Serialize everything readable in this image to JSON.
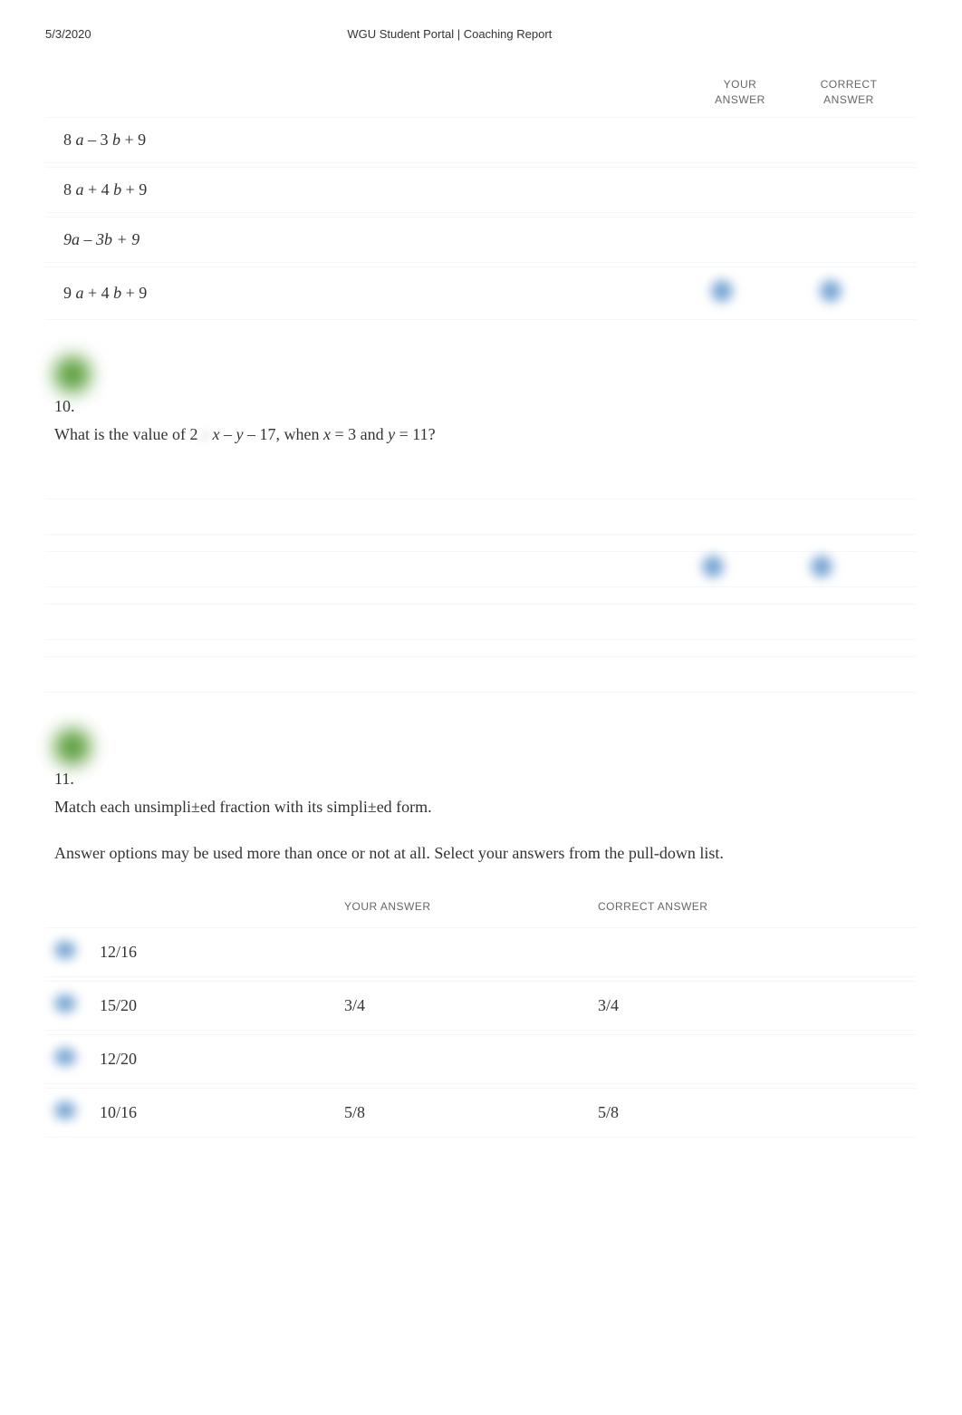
{
  "header": {
    "date": "5/3/2020",
    "title": "WGU Student Portal | Coaching Report"
  },
  "columns": {
    "your_answer": "YOUR ANSWER",
    "correct_answer": "CORRECT ANSWER"
  },
  "q9_options": [
    {
      "text": "8 a – 3  b + 9",
      "your": false,
      "correct": false
    },
    {
      "text": "8 a + 4  b + 9",
      "your": false,
      "correct": false
    },
    {
      "text": "9a – 3b + 9",
      "your": false,
      "correct": false,
      "italic": true
    },
    {
      "text": "9 a + 4  b + 9",
      "your": true,
      "correct": true
    }
  ],
  "q10": {
    "number": "10.",
    "text_parts": {
      "p1": "What is the value of 2",
      "p2": "x",
      "p3": "  –  ",
      "p4": "y",
      "p5": " – 17, when   ",
      "p6": "x",
      "p7": " = 3 and  ",
      "p8": "y",
      "p9": " = 11?"
    },
    "rows": [
      {
        "your": false,
        "correct": false
      },
      {
        "your": true,
        "correct": true
      },
      {
        "your": false,
        "correct": false
      },
      {
        "your": false,
        "correct": false
      }
    ]
  },
  "q11": {
    "number": "11.",
    "prompt": "Match each unsimpli±ed fraction with its simpli±ed form.",
    "note": "Answer options may be used more than once or not at all. Select your answers from the pull-down list.",
    "headers": {
      "your": "YOUR ANSWER",
      "correct": "CORRECT ANSWER"
    },
    "rows": [
      {
        "fraction": "12/16",
        "your": "",
        "correct": ""
      },
      {
        "fraction": "15/20",
        "your": "3/4",
        "correct": "3/4"
      },
      {
        "fraction": "12/20",
        "your": "",
        "correct": ""
      },
      {
        "fraction": "10/16",
        "your": "5/8",
        "correct": "5/8"
      }
    ]
  }
}
